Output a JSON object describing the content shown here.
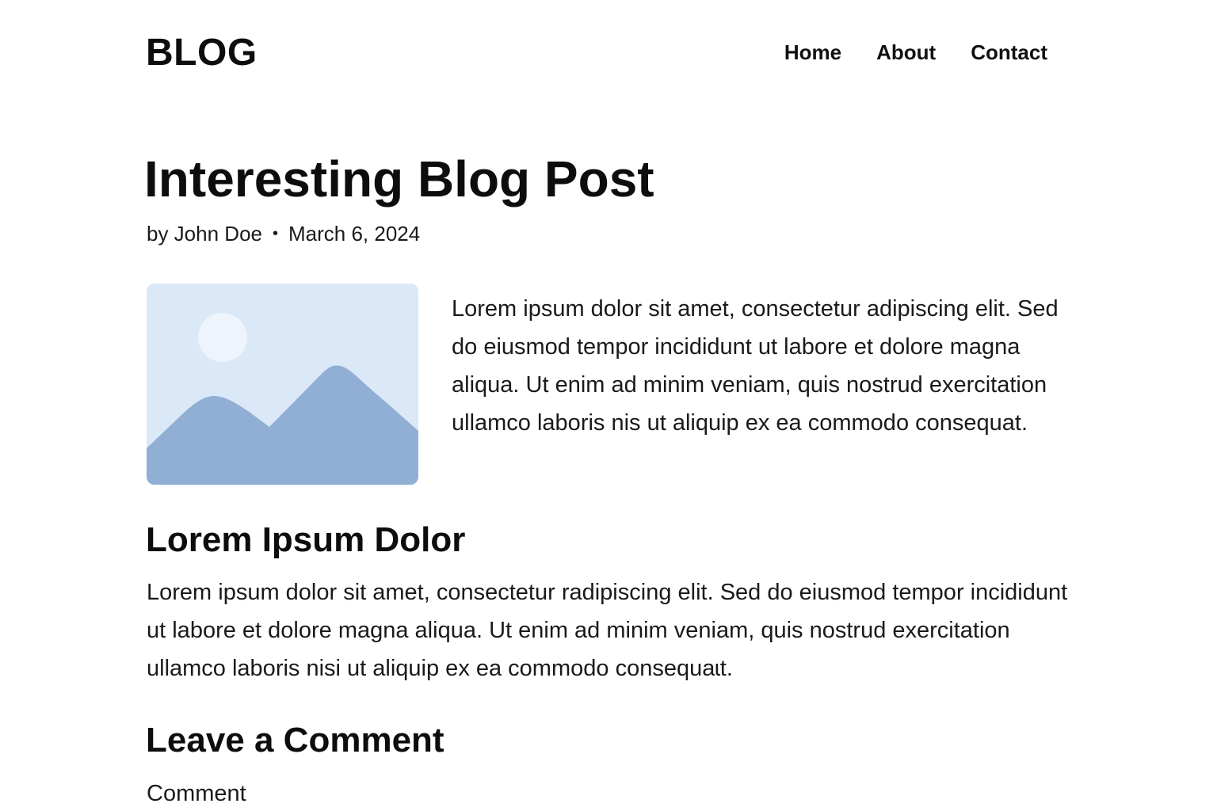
{
  "header": {
    "logo": "BLOG",
    "nav": [
      {
        "label": "Home"
      },
      {
        "label": "About"
      },
      {
        "label": "Contact"
      }
    ]
  },
  "post": {
    "title": "Interesting Blog Post",
    "author": "by John Doe",
    "separator": "•",
    "date": "March 6, 2024",
    "image_icon": "image-placeholder-icon",
    "image_colors": {
      "background": "#dae8f7",
      "sun": "#eef4fc",
      "mountains": "#91aed4"
    },
    "intro": "Lorem ipsum dolor sit amet, consectetur adipiscing elit. Sed do eiusmod tempor incididunt ut labore et dolore magna aliqua. Ut enim ad minim veniam, quis nostrud exercitation ullamco laboris nis ut aliquip ex ea commodo consequat."
  },
  "section": {
    "heading": "Lorem Ipsum Dolor",
    "body": "Lorem ipsum dolor sit amet, consectetur radipiscing  elit. Sed do eiusmod tempor incididunt ut labore et dolore magna aliqua. Ut enim ad minim veniam, quis nostrud exercitation ullamco laboris nisi ut aliquip ex ea commodo consequaɩt."
  },
  "comments": {
    "heading": "Leave a Comment",
    "field_label": "Comment"
  }
}
